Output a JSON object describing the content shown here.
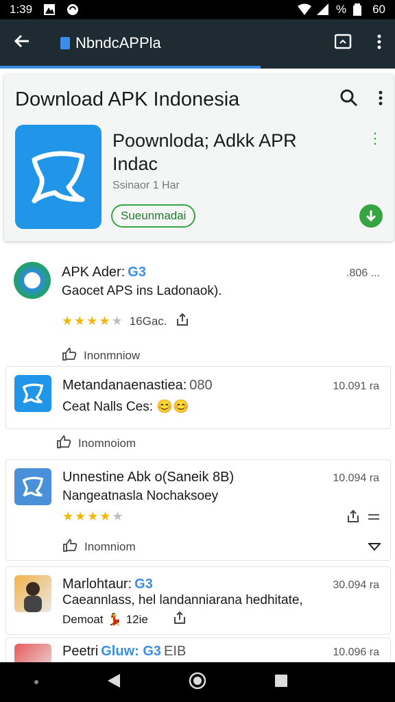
{
  "status_bar": {
    "time": "1:39",
    "battery_text": "%",
    "signal_text": "60"
  },
  "app_bar": {
    "title": "NbndcAPPla"
  },
  "progress": {
    "value": 0.66
  },
  "card": {
    "header_title": "Download APK Indonesia",
    "app_name": "Poownloda; Adkk APR Indac",
    "app_sub": "Ssinaor 1 Har",
    "install_label": "Sueunmadai"
  },
  "items": [
    {
      "name": "APK Ader:",
      "tag": "G3",
      "desc": "Gaocet APS ins Ladonaok).",
      "meta": ".806 ...",
      "rating": 4,
      "rating_text": "16Gac.",
      "reco": "Inonmniow"
    },
    {
      "name": "Metandanaenastiea:",
      "extra": "080",
      "desc": "Ceat Nalls Ces:",
      "meta": "10.091 ra",
      "reco": "Inomnoiom"
    },
    {
      "name": "Unnestine Abk o(Saneik 8B)",
      "desc": "Nangeatnasla Nochaksoey",
      "meta": "10.094 ra",
      "rating": 4,
      "reco": "Inomniom"
    },
    {
      "name": "Marlohtaur:",
      "tag": "G3",
      "desc": "Caeannlass, hel landanniarana hedhitate,",
      "desc2": "Demoat",
      "desc2_extra": "12ie",
      "meta": "30.094 ra"
    },
    {
      "name": "Peetri",
      "tag": "Gluw: G3",
      "extra": "EIB",
      "meta": "10.096 ra"
    }
  ]
}
